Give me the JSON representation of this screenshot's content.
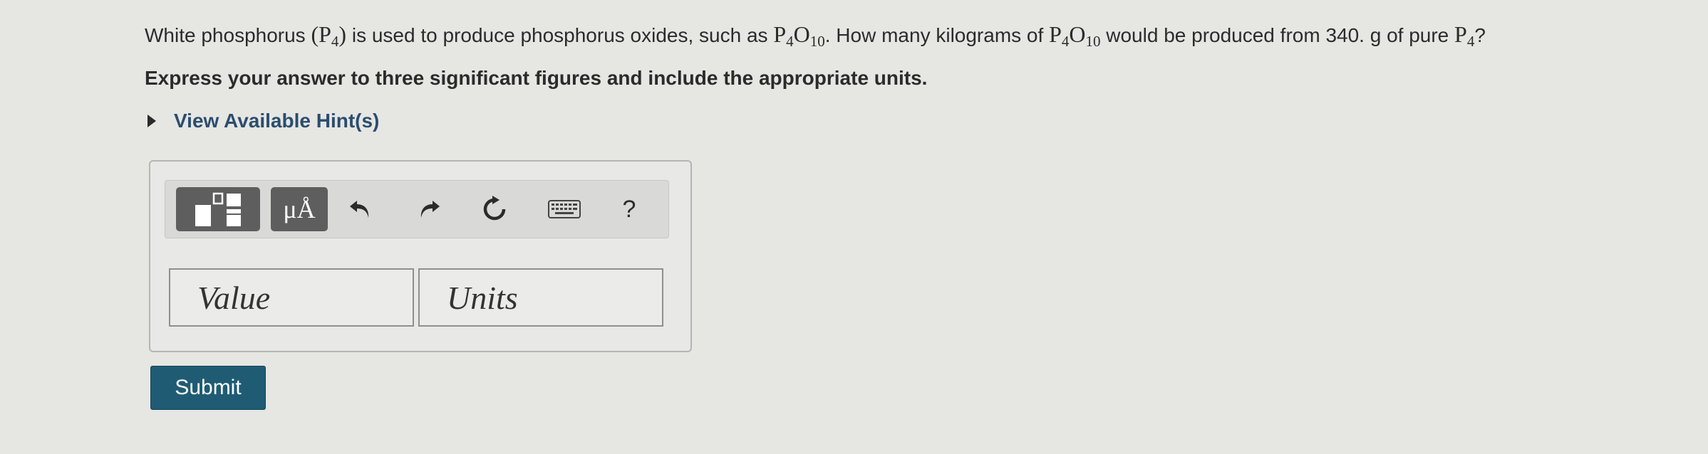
{
  "question": {
    "part1": "White phosphorus ",
    "paren_open": "(",
    "p4_a_base": "P",
    "p4_a_sub": "4",
    "paren_close": ")",
    "part2": " is used to produce phosphorus oxides, such as ",
    "oxide_a_p": "P",
    "oxide_a_p_sub": "4",
    "oxide_a_o": "O",
    "oxide_a_o_sub": "10",
    "part3": ". How many kilograms of ",
    "oxide_b_p": "P",
    "oxide_b_p_sub": "4",
    "oxide_b_o": "O",
    "oxide_b_o_sub": "10",
    "part4": " would be produced from 340. g of pure ",
    "p4_b_base": "P",
    "p4_b_sub": "4",
    "part5": "?"
  },
  "instruction": "Express your answer to three significant figures and include the appropriate units.",
  "hint_label": "View Available Hint(s)",
  "toolbar": {
    "units_label": "μÅ",
    "help_label": "?"
  },
  "fields": {
    "value_placeholder": "Value",
    "units_placeholder": "Units"
  },
  "submit_label": "Submit",
  "icons": {
    "templates": "templates-icon",
    "units": "units-icon",
    "undo": "undo-icon",
    "redo": "redo-icon",
    "reset": "reset-icon",
    "keyboard": "keyboard-icon",
    "help": "help-icon",
    "hint_toggle": "triangle-right-icon"
  },
  "colors": {
    "submit_bg": "#1f5c74",
    "hint_text": "#2b4d6d",
    "toolbar_button": "#5e5e5e"
  }
}
